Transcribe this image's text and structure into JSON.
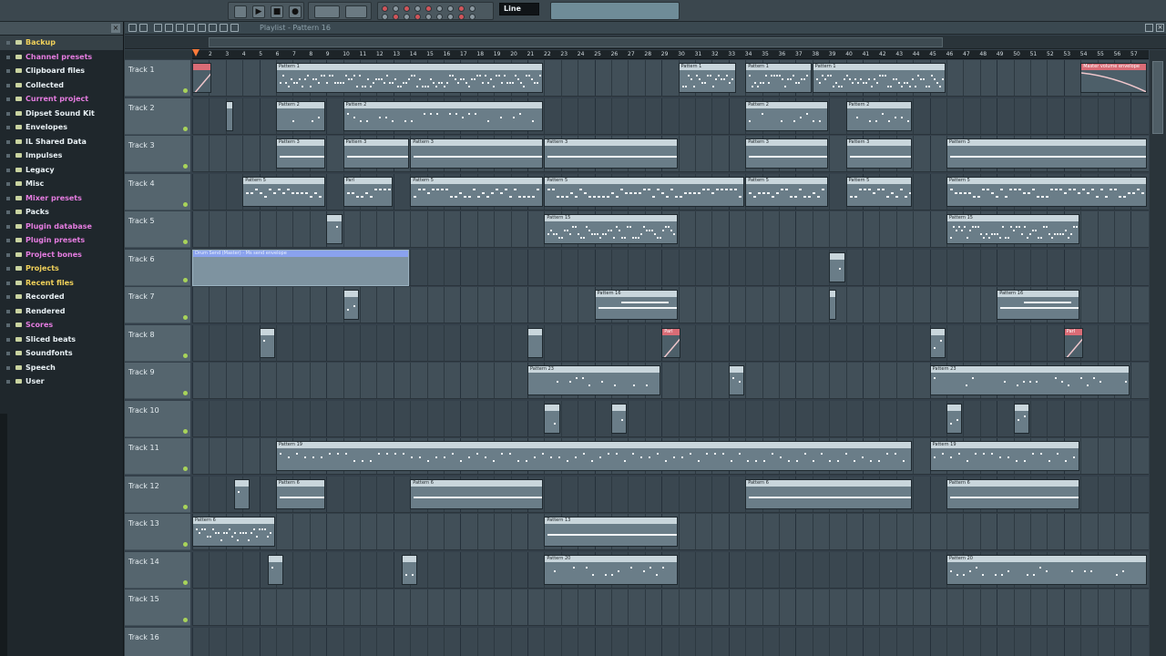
{
  "toolbar": {
    "tempo_mode": "Line"
  },
  "browser": {
    "title": "",
    "close_icon": "close-icon",
    "folders": [
      {
        "label": "Backup",
        "color": "#f2d25a"
      },
      {
        "label": "Channel presets",
        "color": "#e57ce0"
      },
      {
        "label": "Clipboard files",
        "color": "#e9f1f5"
      },
      {
        "label": "Collected",
        "color": "#e9f1f5"
      },
      {
        "label": "Current project",
        "color": "#e57ce0"
      },
      {
        "label": "Dipset Sound Kit",
        "color": "#e9f1f5"
      },
      {
        "label": "Envelopes",
        "color": "#e9f1f5"
      },
      {
        "label": "IL Shared Data",
        "color": "#e9f1f5"
      },
      {
        "label": "Impulses",
        "color": "#e9f1f5"
      },
      {
        "label": "Legacy",
        "color": "#e9f1f5"
      },
      {
        "label": "Misc",
        "color": "#e9f1f5"
      },
      {
        "label": "Mixer presets",
        "color": "#e57ce0"
      },
      {
        "label": "Packs",
        "color": "#e9f1f5"
      },
      {
        "label": "Plugin database",
        "color": "#e57ce0"
      },
      {
        "label": "Plugin presets",
        "color": "#e57ce0"
      },
      {
        "label": "Project bones",
        "color": "#e57ce0"
      },
      {
        "label": "Projects",
        "color": "#f2d25a"
      },
      {
        "label": "Recent files",
        "color": "#f2d25a"
      },
      {
        "label": "Recorded",
        "color": "#e9f1f5"
      },
      {
        "label": "Rendered",
        "color": "#e9f1f5"
      },
      {
        "label": "Scores",
        "color": "#e57ce0"
      },
      {
        "label": "Sliced beats",
        "color": "#e9f1f5"
      },
      {
        "label": "Soundfonts",
        "color": "#e9f1f5"
      },
      {
        "label": "Speech",
        "color": "#e9f1f5"
      },
      {
        "label": "User",
        "color": "#e9f1f5"
      }
    ]
  },
  "playlist": {
    "title": "Playlist - Pattern 16",
    "ruler": [
      "2",
      "3",
      "4",
      "5",
      "6",
      "7",
      "8",
      "9",
      "10",
      "11",
      "12",
      "13",
      "14",
      "15",
      "16",
      "17",
      "18",
      "19",
      "20",
      "21",
      "22",
      "23",
      "24",
      "25",
      "26",
      "27",
      "28",
      "29",
      "30",
      "31",
      "32",
      "33",
      "34",
      "35",
      "36",
      "37",
      "38",
      "39",
      "40",
      "41",
      "42",
      "43",
      "44",
      "45",
      "46",
      "47",
      "48",
      "49",
      "50",
      "51",
      "52",
      "53",
      "54",
      "55",
      "56",
      "57"
    ],
    "tracks": [
      {
        "name": "Track 1"
      },
      {
        "name": "Track 2"
      },
      {
        "name": "Track 3"
      },
      {
        "name": "Track 4"
      },
      {
        "name": "Track 5"
      },
      {
        "name": "Track 6"
      },
      {
        "name": "Track 7"
      },
      {
        "name": "Track 8"
      },
      {
        "name": "Track 9"
      },
      {
        "name": "Track 10"
      },
      {
        "name": "Track 11"
      },
      {
        "name": "Track 12"
      },
      {
        "name": "Track 13"
      },
      {
        "name": "Track 14"
      },
      {
        "name": "Track 15"
      },
      {
        "name": "Track 16"
      }
    ],
    "clip_labels": {
      "p1": "Pattern 1",
      "p2": "Pattern 2",
      "p3": "Pattern 3",
      "p5": "Pattern 5",
      "p6": "Pattern 6",
      "p13": "Pattern 13",
      "p16": "Pattern 16",
      "p15": "Pattern 15",
      "p19": "Pattern 19",
      "p20": "Pattern 20",
      "p23": "Pattern 23",
      "master_vol": "Master volume envelope",
      "env": "Drum Send (Master) - Ms send envelope",
      "short": "Parl"
    }
  }
}
